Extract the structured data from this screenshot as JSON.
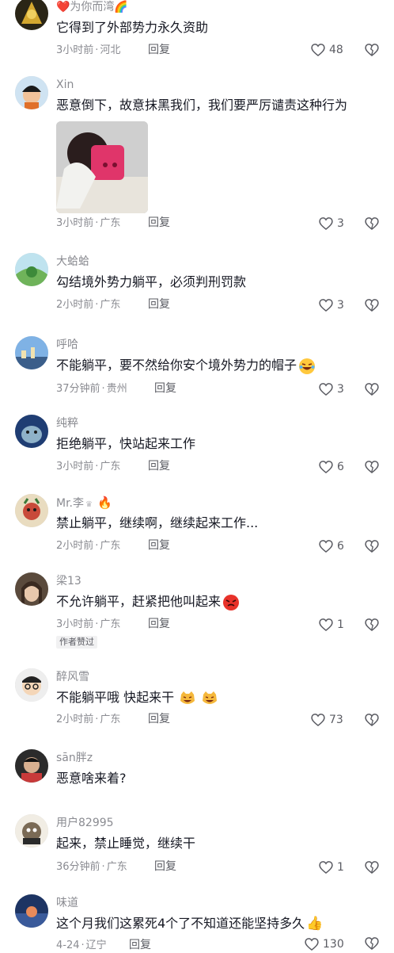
{
  "comments": [
    {
      "username": "❤️为你而湾🌈",
      "text": "它得到了外部势力永久资助",
      "time": "3小时前",
      "location": "河北",
      "likes": "48",
      "avatar_color": "#c9a227"
    },
    {
      "username": "Xin",
      "text": "恶意倒下，故意抹黑我们，我们要严厉谴责这种行为",
      "time": "3小时前",
      "location": "广东",
      "likes": "3",
      "avatar_color": "#e08a2a"
    },
    {
      "username": "大蛤蛤",
      "text": "勾结境外势力躺平，必须判刑罚款",
      "time": "2小时前",
      "location": "广东",
      "likes": "3",
      "avatar_color": "#6fb35a"
    },
    {
      "username": "呼哈",
      "text": "不能躺平，要不然给你安个境外势力的帽子",
      "time": "37分钟前",
      "location": "贵州",
      "likes": "3",
      "avatar_color": "#4c7cc4"
    },
    {
      "username": "纯粹",
      "text": "拒绝躺平，快站起来工作",
      "time": "3小时前",
      "location": "广东",
      "likes": "6",
      "avatar_color": "#1f3d73"
    },
    {
      "username": "Mr.李",
      "text": "禁止躺平，继续啊，继续起来工作...",
      "time": "2小时前",
      "location": "广东",
      "likes": "6",
      "avatar_color": "#d9c9a8"
    },
    {
      "username": "梁13",
      "text": "不允许躺平，赶紧把他叫起来",
      "time": "3小时前",
      "location": "广东",
      "likes": "1",
      "avatar_color": "#6b5a4a",
      "badge": "作者赞过"
    },
    {
      "username": "醉风雪",
      "text": "不能躺平哦 快起来干",
      "time": "2小时前",
      "location": "广东",
      "likes": "73",
      "avatar_color": "#dcdcdc"
    },
    {
      "username": "sān胖z",
      "text": "恶意啥来着?",
      "avatar_color": "#3a3a3a"
    },
    {
      "username": "用户82995",
      "text": "起来，禁止睡觉，继续干",
      "time": "36分钟前",
      "location": "广东",
      "likes": "1",
      "avatar_color": "#7a6a55"
    },
    {
      "username": "味道",
      "text": "这个月我们这累死4个了不知道还能坚持多久",
      "time": "4-24",
      "location": "辽宁",
      "likes": "130",
      "avatar_color": "#2c4f8a"
    }
  ],
  "reply_label": "回复",
  "separator": "·",
  "icons": {
    "like": "heart-outline-icon",
    "dislike": "broken-heart-icon"
  }
}
